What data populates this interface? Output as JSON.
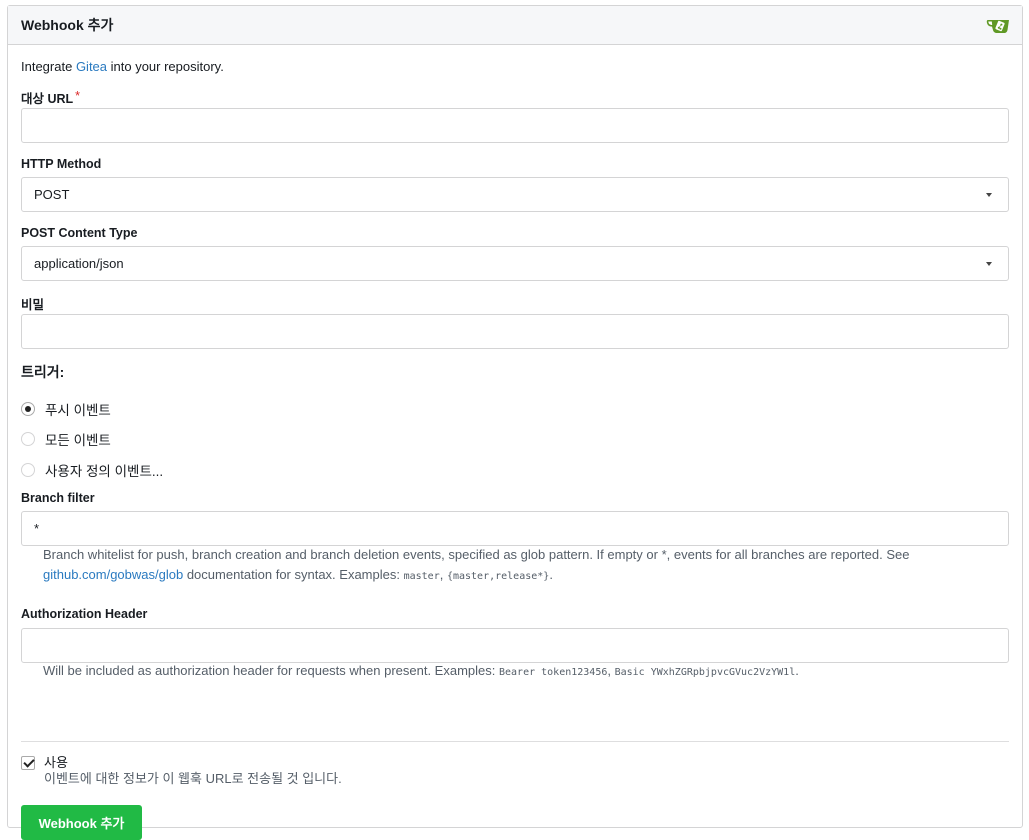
{
  "header": {
    "title": "Webhook 추가",
    "logo_icon": "gitea-logo-icon"
  },
  "intro": {
    "prefix": "Integrate ",
    "link": "Gitea",
    "suffix": " into your repository."
  },
  "fields": {
    "target_url": {
      "label": "대상 URL",
      "required_mark": "*",
      "value": ""
    },
    "http_method": {
      "label": "HTTP Method",
      "value": "POST"
    },
    "content_type": {
      "label": "POST Content Type",
      "value": "application/json"
    },
    "secret": {
      "label": "비밀",
      "value": ""
    },
    "branch_filter": {
      "label": "Branch filter",
      "value": "*",
      "help_part1": "Branch whitelist for push, branch creation and branch deletion events, specified as glob pattern. If empty or ",
      "help_code_star": "*",
      "help_part2": ", events for all branches are reported. See",
      "help_link": "github.com/gobwas/glob",
      "help_part3": " documentation for syntax. Examples: ",
      "help_ex1": "master",
      "help_sep": ", ",
      "help_ex2": "{master,release*}",
      "help_end": "."
    },
    "auth_header": {
      "label": "Authorization Header",
      "value": "",
      "help_part1": "Will be included as authorization header for requests when present. Examples: ",
      "help_ex1": "Bearer token123456",
      "help_sep": ", ",
      "help_ex2": "Basic YWxhZGRpbjpvcGVuc2VzYW1l",
      "help_end": "."
    }
  },
  "triggers": {
    "title": "트리거:",
    "options": [
      {
        "label": "푸시 이벤트",
        "selected": true
      },
      {
        "label": "모든 이벤트",
        "selected": false
      },
      {
        "label": "사용자 정의 이벤트...",
        "selected": false
      }
    ]
  },
  "active": {
    "label": "사용",
    "description": "이벤트에 대한 정보가 이 웹훅 URL로 전송될 것 입니다.",
    "checked": true
  },
  "submit_label": "Webhook 추가",
  "colors": {
    "primary": "#21ba45",
    "link": "#2a7ac0",
    "required": "#db2828",
    "logo": "#609926"
  }
}
